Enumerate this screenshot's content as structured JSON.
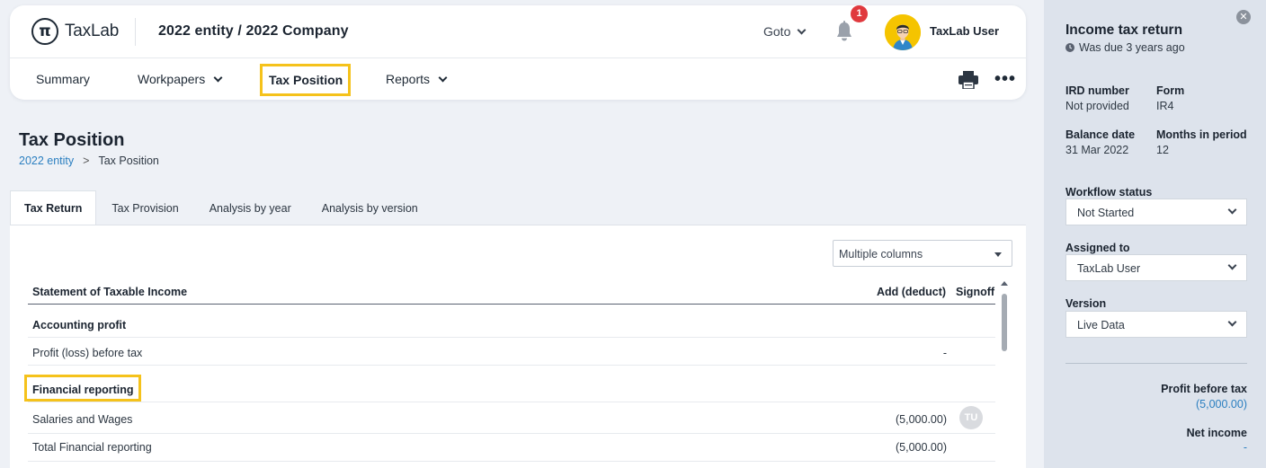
{
  "header": {
    "logo_mark": "π",
    "logo_text": "TaxLab",
    "company": "2022 entity / 2022 Company",
    "goto_label": "Goto",
    "notification_count": "1",
    "username": "TaxLab User"
  },
  "nav": {
    "summary": "Summary",
    "workpapers": "Workpapers",
    "tax_position": "Tax Position",
    "reports": "Reports",
    "more": "•••"
  },
  "page": {
    "title": "Tax Position",
    "breadcrumb_link": "2022 entity",
    "breadcrumb_sep": ">",
    "breadcrumb_current": "Tax Position"
  },
  "tabs": [
    {
      "label": "Tax Return",
      "active": true
    },
    {
      "label": "Tax Provision",
      "active": false
    },
    {
      "label": "Analysis by year",
      "active": false
    },
    {
      "label": "Analysis by version",
      "active": false
    }
  ],
  "columns_select": "Multiple columns",
  "table": {
    "col_statement": "Statement of Taxable Income",
    "col_add": "Add (deduct)",
    "col_signoff": "Signoff",
    "rows": [
      {
        "label": "Accounting profit",
        "type": "section",
        "amount": ""
      },
      {
        "label": "Profit (loss) before tax",
        "type": "item",
        "amount": "-"
      },
      {
        "label": "Financial reporting",
        "type": "section",
        "amount": ""
      },
      {
        "label": "Salaries and Wages",
        "type": "item",
        "amount": "(5,000.00)",
        "signoff": "TU"
      },
      {
        "label": "Total Financial reporting",
        "type": "item",
        "amount": "(5,000.00)"
      }
    ]
  },
  "sidebar": {
    "close": "✕",
    "title": "Income tax return",
    "due": "Was due 3 years ago",
    "ird_label": "IRD number",
    "ird_value": "Not provided",
    "form_label": "Form",
    "form_value": "IR4",
    "balance_label": "Balance date",
    "balance_value": "31 Mar 2022",
    "months_label": "Months in period",
    "months_value": "12",
    "workflow_label": "Workflow status",
    "workflow_value": "Not Started",
    "assigned_label": "Assigned to",
    "assigned_value": "TaxLab User",
    "version_label": "Version",
    "version_value": "Live Data",
    "profit_label": "Profit before tax",
    "profit_value": "(5,000.00)",
    "net_label": "Net income",
    "net_value": "-"
  },
  "colors": {
    "accent_highlight": "#f5c21b",
    "link": "#2b7fc0",
    "badge": "#e0393e"
  }
}
